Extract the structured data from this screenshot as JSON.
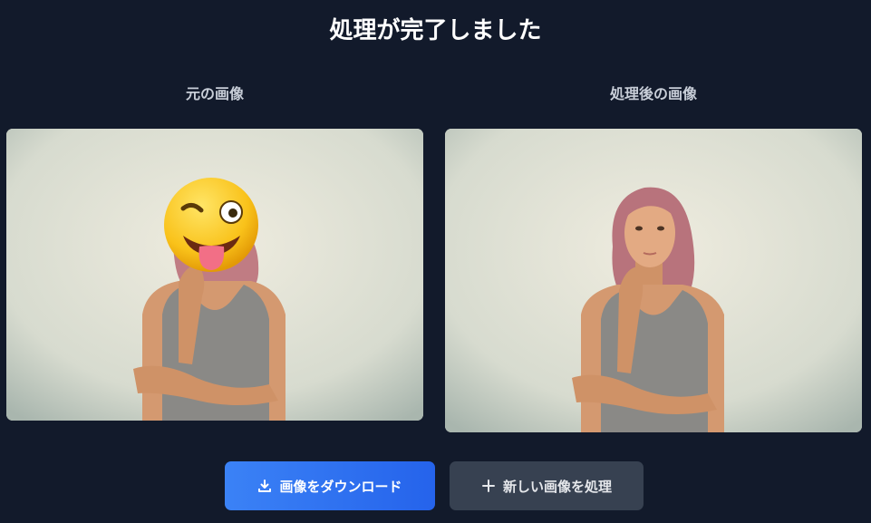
{
  "header": {
    "title": "処理が完了しました"
  },
  "columns": {
    "original_label": "元の画像",
    "processed_label": "処理後の画像"
  },
  "actions": {
    "download_label": "画像をダウンロード",
    "download_icon": "download-icon",
    "new_label": "新しい画像を処理",
    "new_icon": "plus-icon"
  },
  "colors": {
    "background": "#121a2b",
    "primary_button": "#3b82f6",
    "secondary_button": "#374151"
  }
}
